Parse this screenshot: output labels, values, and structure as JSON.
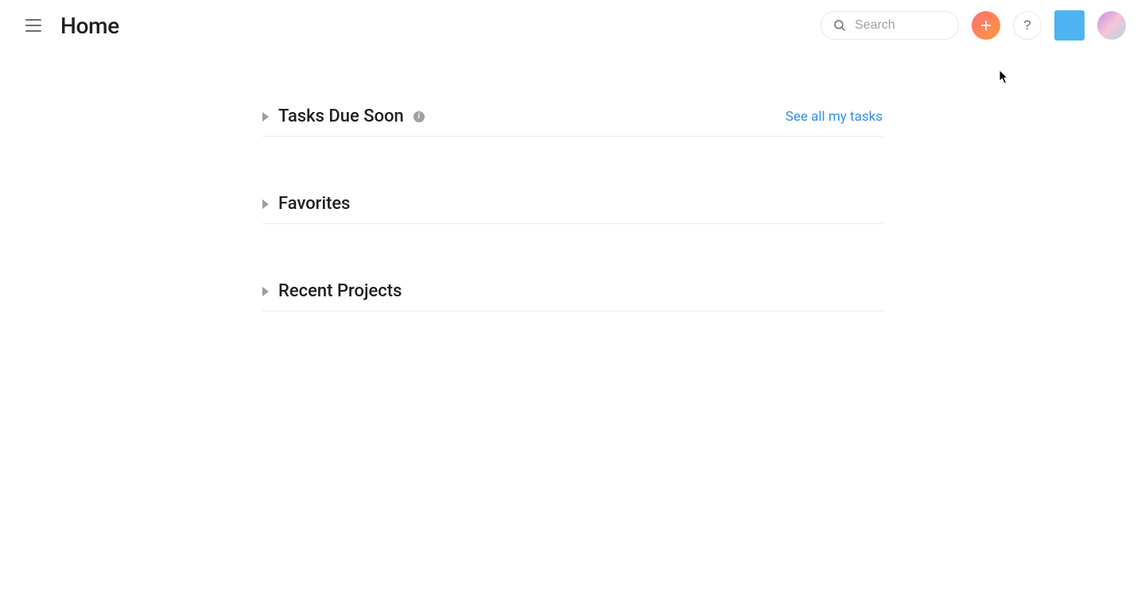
{
  "header": {
    "title": "Home",
    "search_placeholder": "Search",
    "help_label": "?"
  },
  "sections": {
    "tasks": {
      "title": "Tasks Due Soon",
      "link_label": "See all my tasks"
    },
    "favorites": {
      "title": "Favorites"
    },
    "recent": {
      "title": "Recent Projects"
    }
  }
}
